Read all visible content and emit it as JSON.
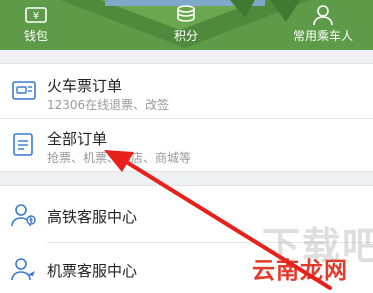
{
  "header": {
    "nav": [
      {
        "label": "钱包",
        "icon": "wallet-icon"
      },
      {
        "label": "积分",
        "icon": "coins-icon"
      },
      {
        "label": "常用乘车人",
        "icon": "person-icon"
      }
    ],
    "color": "#5e9b49"
  },
  "orders": {
    "train": {
      "title": "火车票订单",
      "subtitle": "12306在线退票、改签",
      "icon": "train-ticket-icon"
    },
    "all": {
      "title": "全部订单",
      "subtitle": "抢票、机票、酒店、商城等",
      "icon": "order-list-icon"
    }
  },
  "service": {
    "rail": {
      "title": "高铁客服中心",
      "icon": "rail-support-icon"
    },
    "flight": {
      "title": "机票客服中心",
      "icon": "flight-support-icon"
    }
  },
  "watermark": {
    "brand": "云南龙网",
    "faint": "下载吧"
  },
  "colors": {
    "icon_blue": "#3a7ad0",
    "arrow_red": "#e8201c"
  }
}
